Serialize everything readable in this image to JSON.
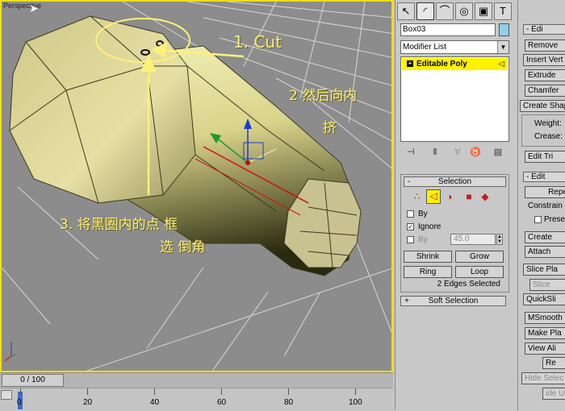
{
  "viewport": {
    "label": "Perspective",
    "annotations": {
      "a1": "1. Cut",
      "a2_line1": "2 然后向内",
      "a2_line2": "挤",
      "a3_line1": "3. 将黑圈内的点 框",
      "a3_line2": "选 倒角"
    }
  },
  "timeline": {
    "frame_display": "0 / 100",
    "ticks": [
      "0",
      "20",
      "40",
      "60",
      "80",
      "100"
    ]
  },
  "panel": {
    "tabs": [
      "create-icon",
      "modify-icon",
      "hierarchy-icon",
      "motion-icon",
      "display-icon",
      "utilities-icon"
    ],
    "object_name": "Box03",
    "object_color": "#8fd0e8",
    "modifier_list": "Modifier List",
    "stack_item": "Editable Poly",
    "selection": {
      "header": "Selection",
      "by_vertex": "By",
      "ignore_backfacing": "Ignore",
      "by_angle": "By",
      "angle_value": "45.0",
      "shrink": "Shrink",
      "grow": "Grow",
      "ring": "Ring",
      "loop": "Loop",
      "status": "2 Edges Selected"
    },
    "soft_selection": "Soft Selection"
  },
  "panel2": {
    "edit_edges_head": "Edi",
    "remove": "Remove",
    "insert_vertex": "Insert Vert",
    "extrude": "Extrude",
    "chamfer": "Chamfer",
    "create_shape": "Create Shape",
    "weight": "Weight:",
    "crease": "Crease:",
    "edit_tri": "Edit Tri",
    "edit_geom_head": "Edit",
    "repeat_last": "Repe",
    "constraints": "Constrain",
    "preserve": "Prese",
    "create": "Create",
    "attach": "Attach",
    "slice_plane": "Slice Pla",
    "slice": "Slice",
    "quickslice": "QuickSli",
    "msmooth": "MSmooth",
    "make_planar": "Make Pla",
    "view_align": "View Ali",
    "reset_plane": "Re",
    "hide_selected": "Hide Selec",
    "unhide": "ide U"
  },
  "colors": {
    "viewport_border": "#f0e000",
    "stack_highlight": "#fff200",
    "annotation": "#fff07a"
  }
}
